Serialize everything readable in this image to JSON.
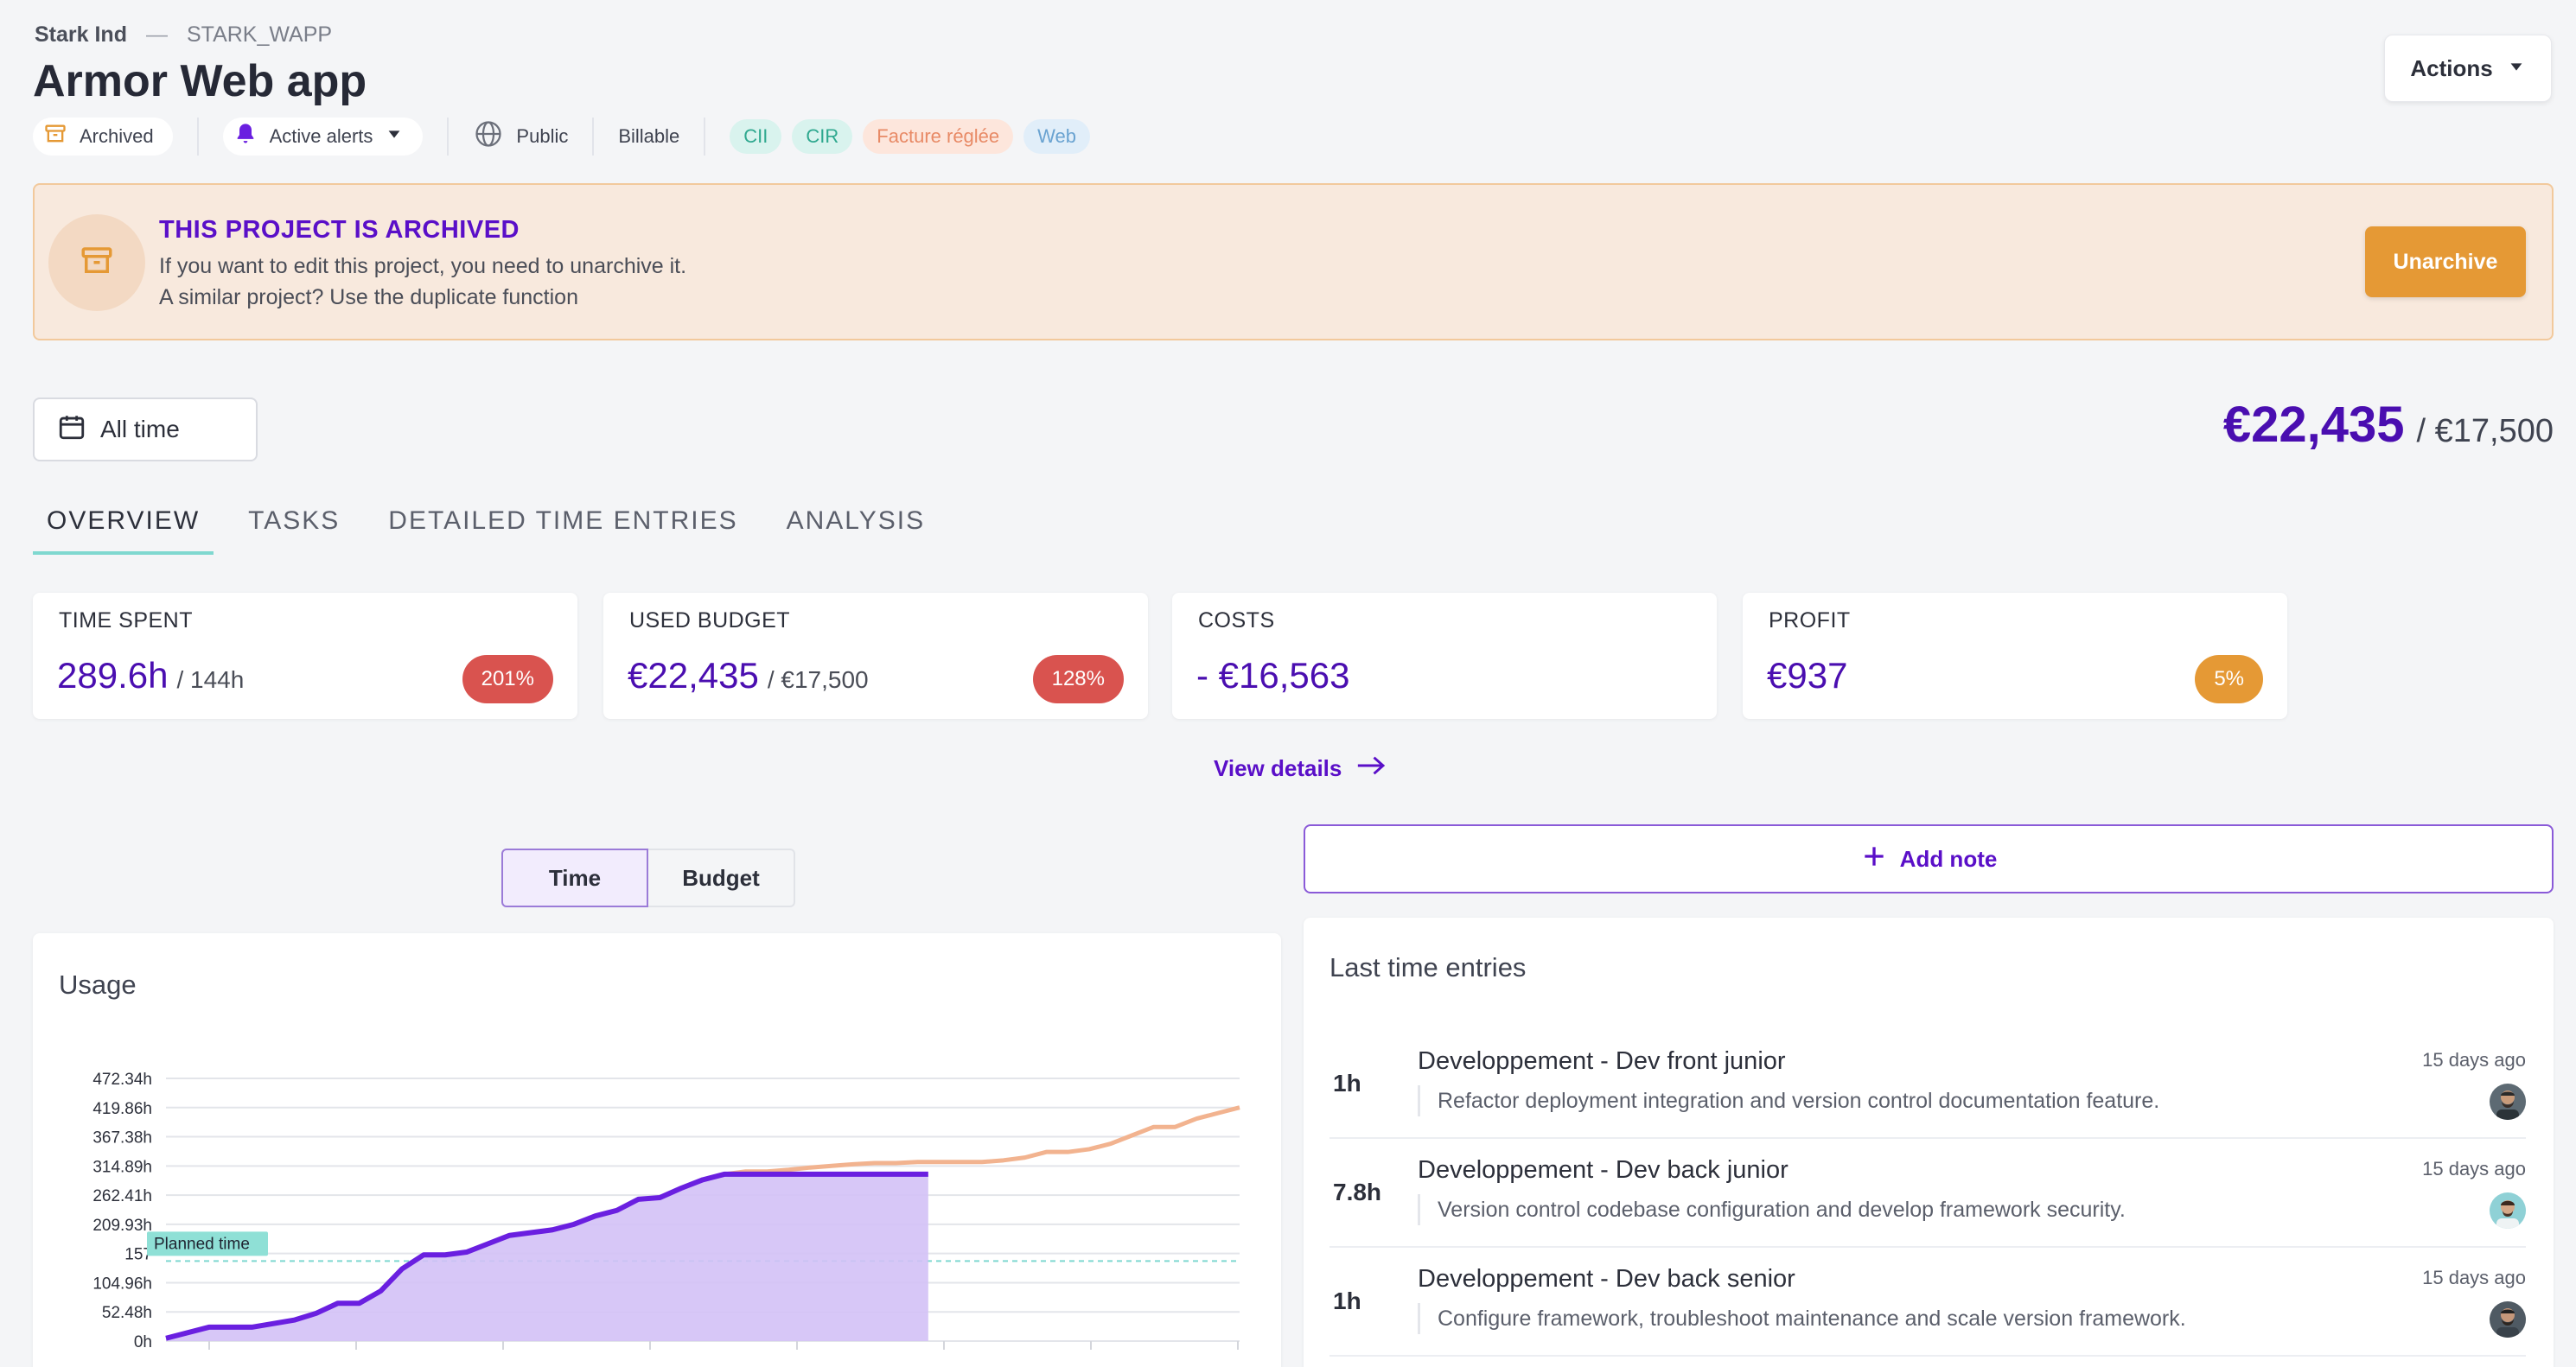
{
  "header": {
    "org": "Stark Ind",
    "separator": "—",
    "project_code": "STARK_WAPP",
    "title": "Armor Web app",
    "actions_label": "Actions"
  },
  "meta": {
    "archived_label": "Archived",
    "alerts_label": "Active alerts",
    "visibility_label": "Public",
    "billable_label": "Billable",
    "tags": [
      "CII",
      "CIR",
      "Facture réglée",
      "Web"
    ]
  },
  "banner": {
    "title": "THIS PROJECT IS ARCHIVED",
    "line1": "If you want to edit this project, you need to unarchive it.",
    "line2": "A similar project? Use the duplicate function",
    "button_label": "Unarchive"
  },
  "filter": {
    "date_label": "All time"
  },
  "budget_total": {
    "spent": "€22,435",
    "total": "/ €17,500"
  },
  "tabs": [
    "OVERVIEW",
    "TASKS",
    "DETAILED TIME ENTRIES",
    "ANALYSIS"
  ],
  "kpis": [
    {
      "label": "TIME SPENT",
      "value": "289.6h",
      "sub": "/ 144h",
      "badge": "201%",
      "badge_color": "#d9534f"
    },
    {
      "label": "USED BUDGET",
      "value": "€22,435",
      "sub": "/ €17,500",
      "badge": "128%",
      "badge_color": "#d9534f"
    },
    {
      "label": "COSTS",
      "value": "- €16,563",
      "sub": "",
      "badge": "",
      "badge_color": ""
    },
    {
      "label": "PROFIT",
      "value": "€937",
      "sub": "",
      "badge": "5%",
      "badge_color": "#e59935"
    }
  ],
  "view_details_label": "View details",
  "toggle": {
    "time_label": "Time",
    "budget_label": "Budget"
  },
  "usage": {
    "title": "Usage",
    "planned_label": "Planned time"
  },
  "chart_data": {
    "type": "line",
    "y_ticks": [
      "0h",
      "52.48h",
      "104.96h",
      "157",
      "209.93h",
      "262.41h",
      "314.89h",
      "367.38h",
      "419.86h",
      "472.34h"
    ],
    "ylim": [
      0,
      472.34
    ],
    "planned": 144,
    "series": [
      {
        "name": "",
        "color": "#6a1fe0",
        "x": [
          0,
          0.04,
          0.08,
          0.12,
          0.14,
          0.16,
          0.18,
          0.2,
          0.22,
          0.24,
          0.26,
          0.28,
          0.3,
          0.32,
          0.34,
          0.36,
          0.38,
          0.4,
          0.42,
          0.44,
          0.46,
          0.48,
          0.5,
          0.52,
          0.54,
          0.56,
          0.58,
          0.6,
          0.62,
          0.64,
          0.66,
          0.68,
          0.7,
          0.71
        ],
        "y": [
          5,
          25,
          25,
          38,
          50,
          68,
          68,
          90,
          130,
          155,
          155,
          160,
          175,
          190,
          195,
          200,
          210,
          225,
          235,
          255,
          258,
          275,
          290,
          300,
          300,
          300,
          300,
          300,
          300,
          300,
          300,
          300,
          300,
          300
        ]
      },
      {
        "name": "",
        "color": "#f2b38f",
        "x": [
          0.5,
          0.52,
          0.54,
          0.56,
          0.58,
          0.6,
          0.62,
          0.64,
          0.66,
          0.68,
          0.7,
          0.72,
          0.74,
          0.76,
          0.78,
          0.8,
          0.82,
          0.84,
          0.86,
          0.88,
          0.9,
          0.92,
          0.94,
          0.96,
          0.98,
          1.0
        ],
        "y": [
          290,
          300,
          305,
          305,
          308,
          312,
          315,
          318,
          320,
          320,
          322,
          322,
          322,
          322,
          325,
          330,
          340,
          340,
          345,
          355,
          370,
          385,
          385,
          400,
          410,
          420
        ]
      }
    ]
  },
  "notes": {
    "add_label": "Add note"
  },
  "entries": {
    "title": "Last time entries",
    "items": [
      {
        "hours": "1h",
        "task": "Developpement - Dev front junior",
        "desc": "Refactor deployment integration and version control documentation feature.",
        "ago": "15 days ago"
      },
      {
        "hours": "7.8h",
        "task": "Developpement - Dev back junior",
        "desc": "Version control codebase configuration and develop framework security.",
        "ago": "15 days ago"
      },
      {
        "hours": "1h",
        "task": "Developpement - Dev back senior",
        "desc": "Configure framework, troubleshoot maintenance and scale version framework.",
        "ago": "15 days ago"
      }
    ]
  }
}
